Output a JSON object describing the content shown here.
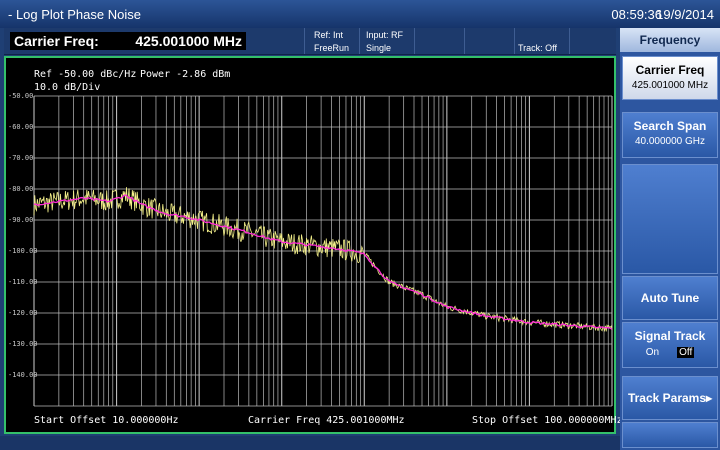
{
  "window": {
    "title": "- Log Plot Phase Noise",
    "time": "08:59:36",
    "date": "19/9/2014"
  },
  "status": {
    "carrier_label": "Carrier Freq:",
    "carrier_value": "425.001000 MHz",
    "ref": "Ref: Int",
    "input": "Input: RF",
    "run": "FreeRun",
    "mode": "Single",
    "track": "Track: Off"
  },
  "plot": {
    "ref_line": "Ref -50.00 dBc/Hz",
    "power": "Power -2.86 dBm",
    "scale": "10.0 dB/Div",
    "start": "Start Offset 10.000000Hz",
    "center": "Carrier Freq 425.001000MHz",
    "stop": "Stop Offset 100.000000MHz",
    "y_ticks": [
      "-50.00",
      "-60.00",
      "-70.00",
      "-80.00",
      "-90.00",
      "-100.00",
      "-110.00",
      "-120.00",
      "-130.00",
      "-140.00"
    ],
    "trace_color": "#ff2bd6",
    "noise_color": "#f4f08a",
    "grid_color": "#bdbdbd",
    "border_color": "#34c06a"
  },
  "chart_data": {
    "type": "line",
    "xscale": "log",
    "xlim": [
      10,
      100000000
    ],
    "ylim": [
      -150,
      -50
    ],
    "ylabel": "dBc/Hz",
    "series": [
      {
        "values_x": [
          10,
          20,
          40,
          80,
          130,
          200,
          400,
          700,
          1000,
          2000,
          4000,
          7000,
          10000,
          20000,
          40000,
          70000,
          100000,
          200000,
          500000,
          1000000,
          3000000,
          10000000,
          30000000,
          100000000
        ],
        "values_y": [
          -85,
          -84,
          -83,
          -84,
          -82,
          -85,
          -88,
          -89,
          -90,
          -92,
          -94,
          -96,
          -97,
          -98,
          -99,
          -100,
          -101,
          -110,
          -114,
          -118,
          -121,
          -123,
          -124,
          -125
        ]
      }
    ]
  },
  "softkeys": {
    "title": "Frequency",
    "items": [
      {
        "label": "Carrier Freq",
        "value": "425.001000 MHz"
      },
      {
        "label": "Search Span",
        "value": "40.000000 GHz"
      },
      {
        "label": "Auto Tune",
        "value": ""
      },
      {
        "label": "Signal Track",
        "on": "On",
        "off": "Off"
      },
      {
        "label": "Track Params",
        "arrow": "▸"
      }
    ]
  }
}
